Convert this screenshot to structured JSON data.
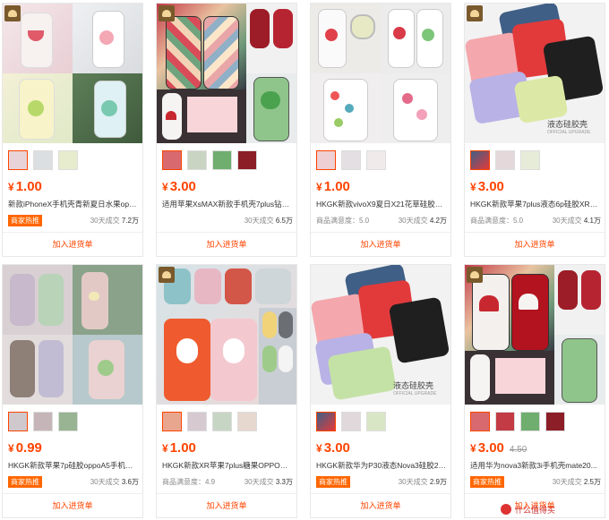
{
  "products": [
    {
      "price": "1.00",
      "old_price": null,
      "title": "新款iPhoneX手机壳青新夏日水果opp...",
      "tag": "商家热推",
      "rating": null,
      "sales_prefix": "30天成交",
      "sales": "7.2万",
      "add_label": "加入进货单",
      "image_label": null,
      "image_sublabel": null
    },
    {
      "price": "3.00",
      "old_price": null,
      "title": "适用苹果XsMAX新款手机壳7plus钻石...",
      "tag": null,
      "rating": null,
      "sales_prefix": "30天成交",
      "sales": "6.5万",
      "add_label": "加入进货单",
      "image_label": null,
      "image_sublabel": null
    },
    {
      "price": "1.00",
      "old_price": null,
      "title": "HKGK新款vivoX9夏日X21花草硅胶X2...",
      "tag": null,
      "rating": "商品满意度：5.0",
      "sales_prefix": "30天成交",
      "sales": "4.2万",
      "add_label": "加入进货单",
      "image_label": null,
      "image_sublabel": null
    },
    {
      "price": "3.00",
      "old_price": null,
      "title": "HKGK新款苹果7plus液态6p硅胶XR手...",
      "tag": null,
      "rating": "商品满意度：5.0",
      "sales_prefix": "30天成交",
      "sales": "4.1万",
      "add_label": "加入进货单",
      "image_label": "液态硅胶壳",
      "image_sublabel": "OFFICIAL UPGRADE"
    },
    {
      "price": "0.99",
      "old_price": null,
      "title": "HKGK新款苹果7p硅胶oppoA5手机壳vi...",
      "tag": "商家热推",
      "rating": null,
      "sales_prefix": "30天成交",
      "sales": "3.6万",
      "add_label": "加入进货单",
      "image_label": null,
      "image_sublabel": null
    },
    {
      "price": "1.00",
      "old_price": null,
      "title": "HKGK新款XR苹果7plus糖果OPPOR15...",
      "tag": null,
      "rating": "商品满意度：4.9",
      "sales_prefix": "30天成交",
      "sales": "3.3万",
      "add_label": "加入进货单",
      "image_label": null,
      "image_sublabel": null
    },
    {
      "price": "3.00",
      "old_price": null,
      "title": "HKGK新款华为P30液态Nova3硅胶2s...",
      "tag": "商家热推",
      "rating": null,
      "sales_prefix": "30天成交",
      "sales": "2.9万",
      "add_label": "加入进货单",
      "image_label": "液态硅胶壳",
      "image_sublabel": "OFFICIAL UPGRADE"
    },
    {
      "price": "3.00",
      "old_price": "4.50",
      "title": "适用华为nova3新款3i手机壳mate20...",
      "tag": "商家热推",
      "rating": null,
      "sales_prefix": "30天成交",
      "sales": "2.5万",
      "add_label": "加入进货单",
      "image_label": null,
      "image_sublabel": null
    }
  ],
  "currency_symbol": "¥",
  "watermark": "什么值得买",
  "colors": {
    "accent": "#ff4400",
    "hot_tag": "#ff6600",
    "border": "#e8e8e8"
  }
}
